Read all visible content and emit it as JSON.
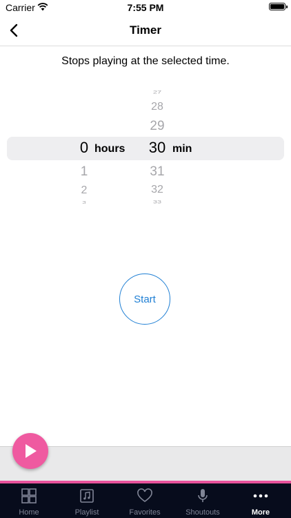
{
  "status_bar": {
    "carrier": "Carrier",
    "time": "7:55 PM"
  },
  "nav": {
    "title": "Timer"
  },
  "subtitle": "Stops playing at the selected time.",
  "picker": {
    "hours": {
      "above": [],
      "selected": "0",
      "below": [
        "1",
        "2",
        "3"
      ],
      "unit": "hours"
    },
    "minutes": {
      "above": [
        "27",
        "28",
        "29"
      ],
      "selected": "30",
      "below": [
        "31",
        "32",
        "33"
      ],
      "unit": "min"
    }
  },
  "start_label": "Start",
  "colors": {
    "accent_blue": "#1f7fd4",
    "accent_pink": "#ef5aa0",
    "tab_bar": "#070c1c"
  },
  "tabs": [
    {
      "label": "Home",
      "icon": "home-grid-icon"
    },
    {
      "label": "Playlist",
      "icon": "playlist-icon"
    },
    {
      "label": "Favorites",
      "icon": "heart-icon"
    },
    {
      "label": "Shoutouts",
      "icon": "microphone-icon"
    },
    {
      "label": "More",
      "icon": "more-dots-icon",
      "active": true
    }
  ]
}
